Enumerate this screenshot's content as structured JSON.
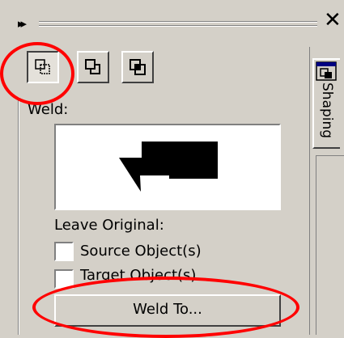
{
  "titlebar": {
    "collapse_glyph": "▸▸",
    "close_glyph": "✕"
  },
  "mode_buttons": [
    {
      "name": "weld",
      "pressed": true
    },
    {
      "name": "trim",
      "pressed": false
    },
    {
      "name": "intersect",
      "pressed": false
    }
  ],
  "panel": {
    "section_label": "Weld:",
    "leave_original_label": "Leave Original:",
    "source_object_label": "Source Object(s)",
    "target_object_label": "Target Object(s)",
    "source_checked": false,
    "target_checked": false,
    "action_button_label": "Weld To..."
  },
  "side_tab": {
    "label": "Shaping"
  },
  "icons": [
    "collapse-icon",
    "close-icon",
    "weld-icon",
    "trim-icon",
    "intersect-icon",
    "shaping-tab-icon"
  ],
  "colors": {
    "panel_bg": "#d4d0c8",
    "annotation": "#ff0000",
    "preview_bg": "#ffffff",
    "shape_fill": "#000000"
  }
}
